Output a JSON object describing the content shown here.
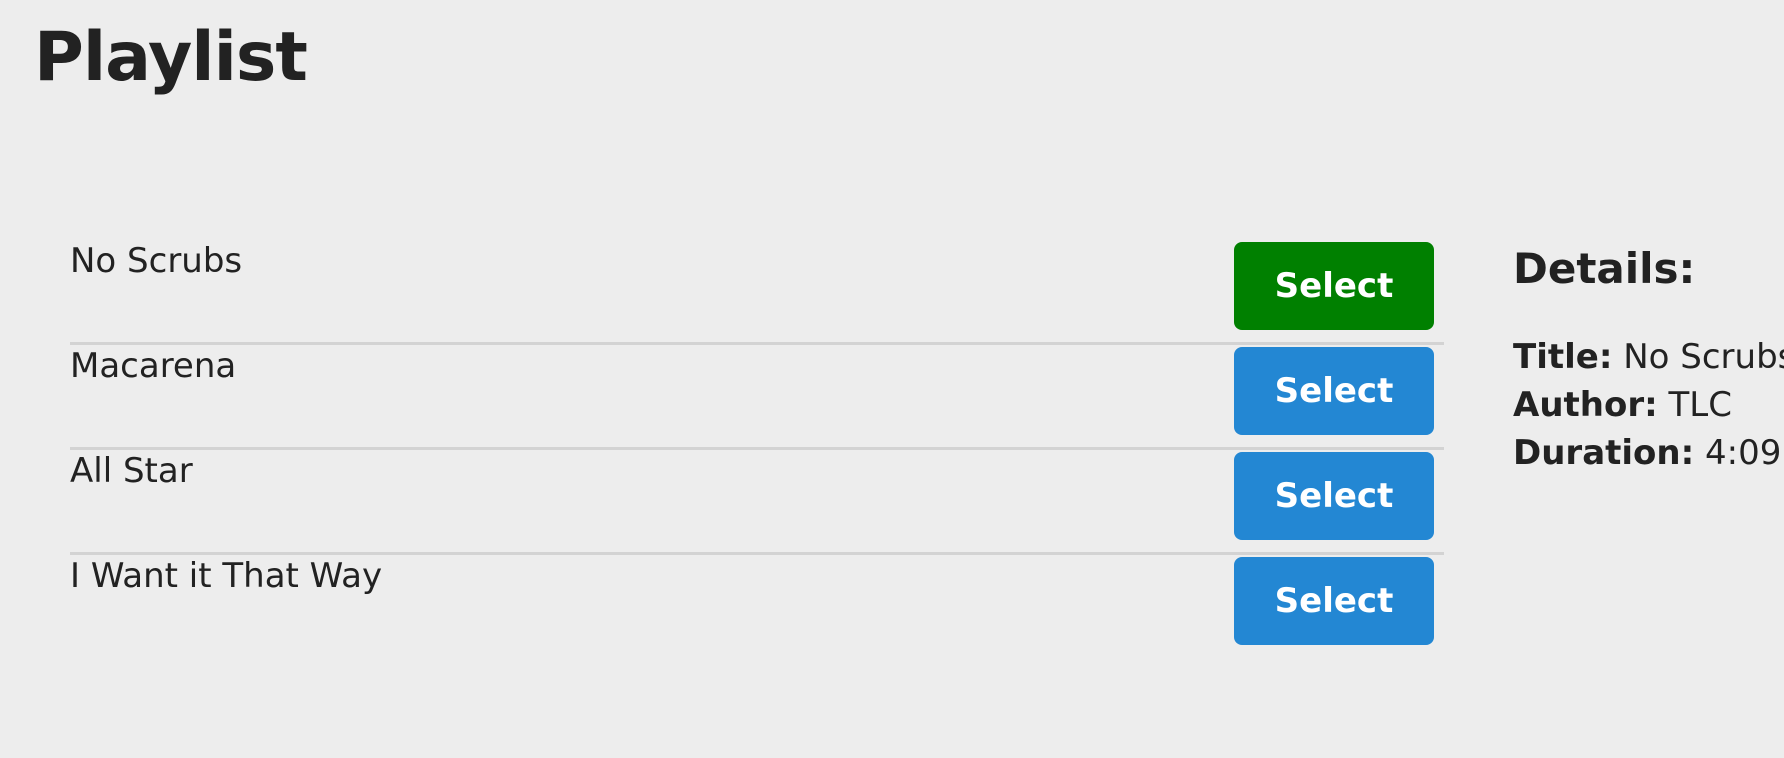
{
  "page": {
    "title": "Playlist"
  },
  "playlist": {
    "items": [
      {
        "title": "No Scrubs",
        "button_label": "Select",
        "selected": true
      },
      {
        "title": "Macarena",
        "button_label": "Select",
        "selected": false
      },
      {
        "title": "All Star",
        "button_label": "Select",
        "selected": false
      },
      {
        "title": "I Want it That Way",
        "button_label": "Select",
        "selected": false
      }
    ]
  },
  "details": {
    "heading": "Details:",
    "title_label": "Title:",
    "title_value": "No Scrubs",
    "author_label": "Author:",
    "author_value": "TLC",
    "duration_label": "Duration:",
    "duration_value": "4:09"
  },
  "colors": {
    "selected_button": "#008000",
    "default_button": "#2387d3",
    "background": "#ededed",
    "divider": "#d3d3d3"
  }
}
